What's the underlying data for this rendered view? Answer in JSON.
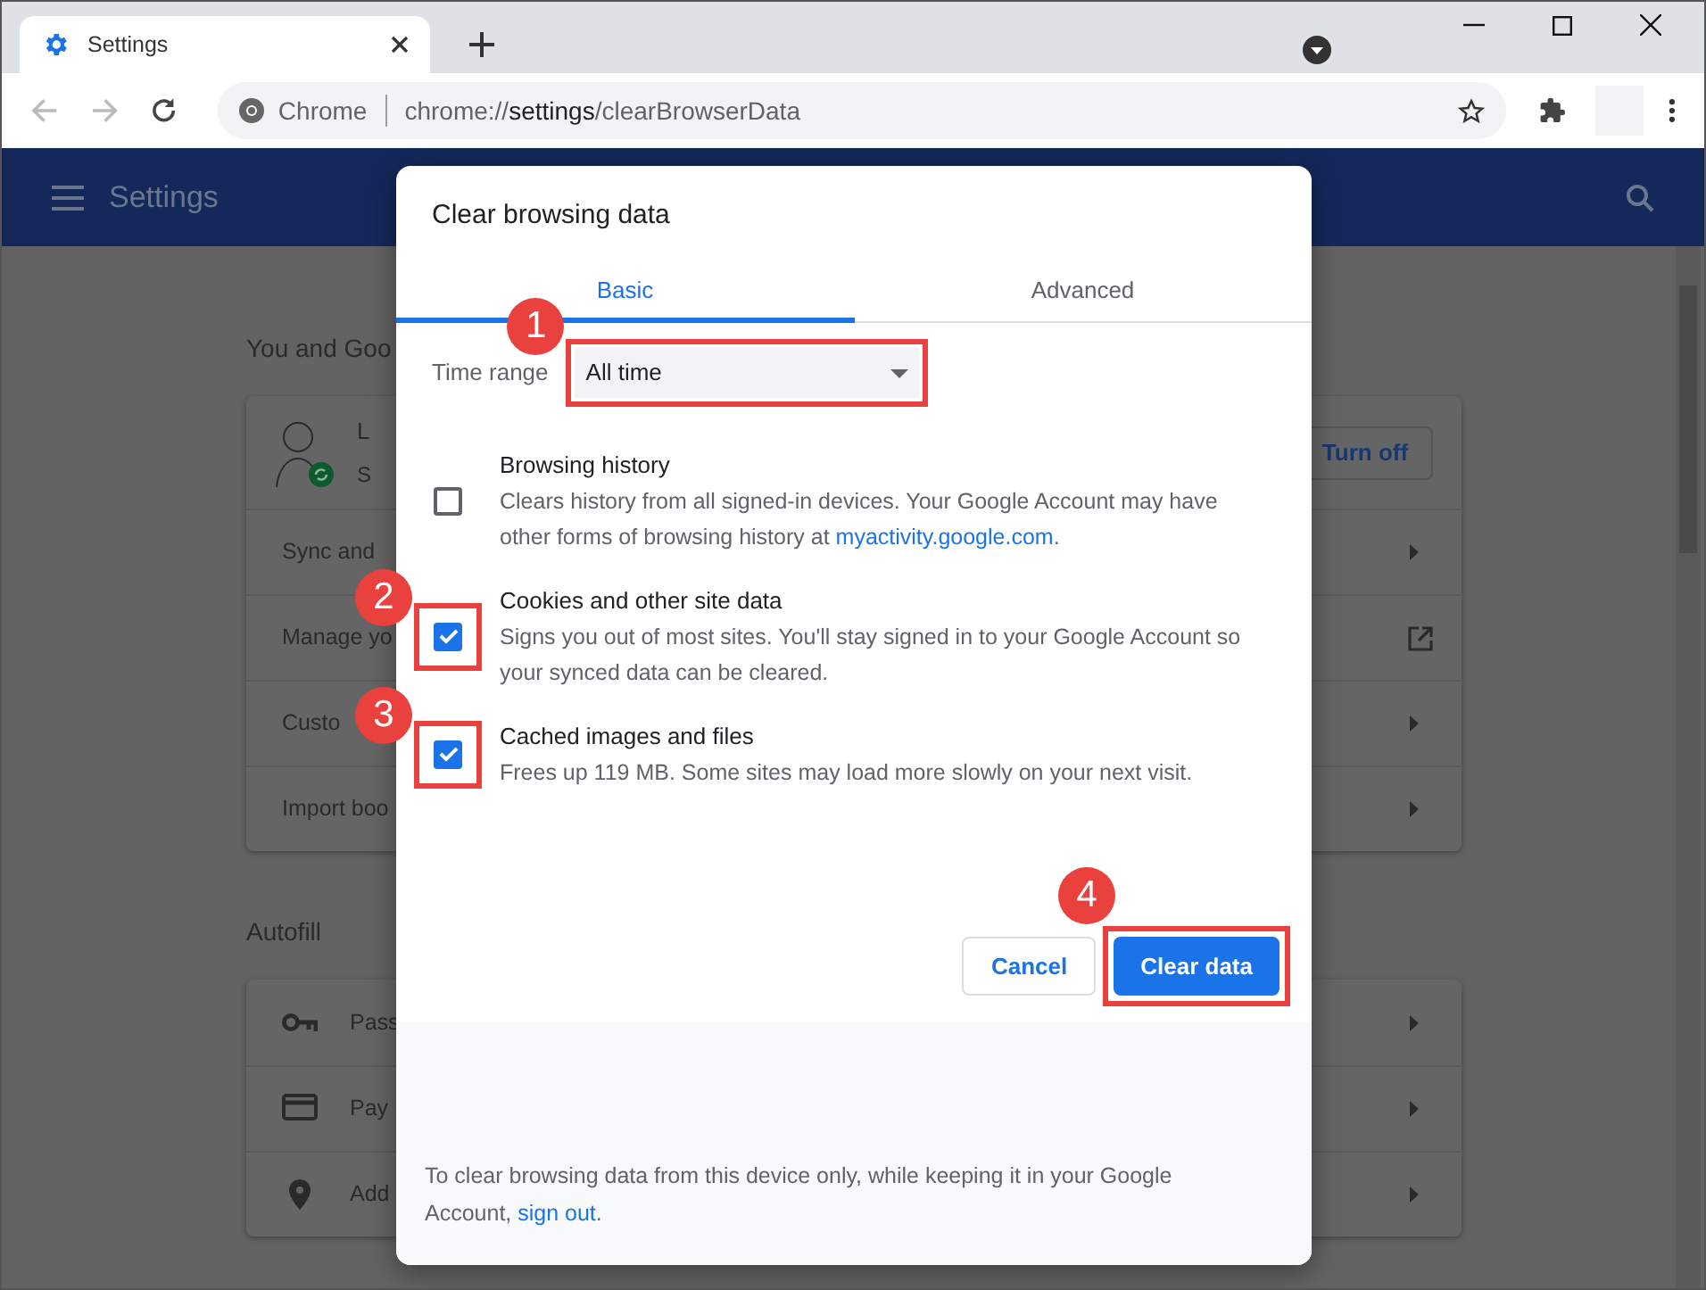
{
  "browser": {
    "tab": {
      "title": "Settings"
    },
    "omnibox": {
      "site_label": "Chrome",
      "url_scheme": "chrome://",
      "url_host": "settings",
      "url_path": "/clearBrowserData"
    }
  },
  "settings_header": {
    "title": "Settings"
  },
  "background": {
    "sections": [
      {
        "title": "You and Goo",
        "rows": [
          {
            "kind": "profile",
            "line_1": "L",
            "line_2": "S",
            "button": "Turn off"
          },
          {
            "kind": "submenu",
            "label": "Sync and"
          },
          {
            "kind": "external",
            "label": "Manage yo"
          },
          {
            "kind": "submenu",
            "label": "Custo"
          },
          {
            "kind": "submenu",
            "label": "Import boo"
          }
        ]
      },
      {
        "title": "Autofill",
        "rows": [
          {
            "kind": "key",
            "label": "Pass"
          },
          {
            "kind": "card",
            "label": "Pay"
          },
          {
            "kind": "pin",
            "label": "Add"
          }
        ]
      }
    ]
  },
  "dialog": {
    "title": "Clear browsing data",
    "tabs": [
      {
        "label": "Basic",
        "selected": true
      },
      {
        "label": "Advanced",
        "selected": false
      }
    ],
    "time_range": {
      "label": "Time range",
      "value": "All time",
      "callout": "1"
    },
    "items": [
      {
        "title": "Browsing history",
        "checked": false,
        "description": [
          {
            "kind": "text",
            "text": "Clears history from all signed-in devices. Your Google Account may have other forms of browsing history at "
          },
          {
            "kind": "link",
            "text": "myactivity.google.com"
          },
          {
            "kind": "text",
            "text": "."
          }
        ]
      },
      {
        "title": "Cookies and other site data",
        "checked": true,
        "callout": "2",
        "description": [
          {
            "kind": "text",
            "text": "Signs you out of most sites. You'll stay signed in to your Google Account so your synced data can be cleared."
          }
        ]
      },
      {
        "title": "Cached images and files",
        "checked": true,
        "callout": "3",
        "description": [
          {
            "kind": "text",
            "text": "Frees up 119 MB. Some sites may load more slowly on your next visit."
          }
        ]
      }
    ],
    "buttons": [
      {
        "kind": "secondary",
        "label": "Cancel"
      },
      {
        "kind": "primary",
        "label": "Clear data",
        "callout": "4"
      }
    ],
    "footer": [
      {
        "kind": "text",
        "text": "To clear browsing data from this device only, while keeping it in your Google Account, "
      },
      {
        "kind": "link",
        "text": "sign out"
      },
      {
        "kind": "text",
        "text": "."
      }
    ]
  }
}
